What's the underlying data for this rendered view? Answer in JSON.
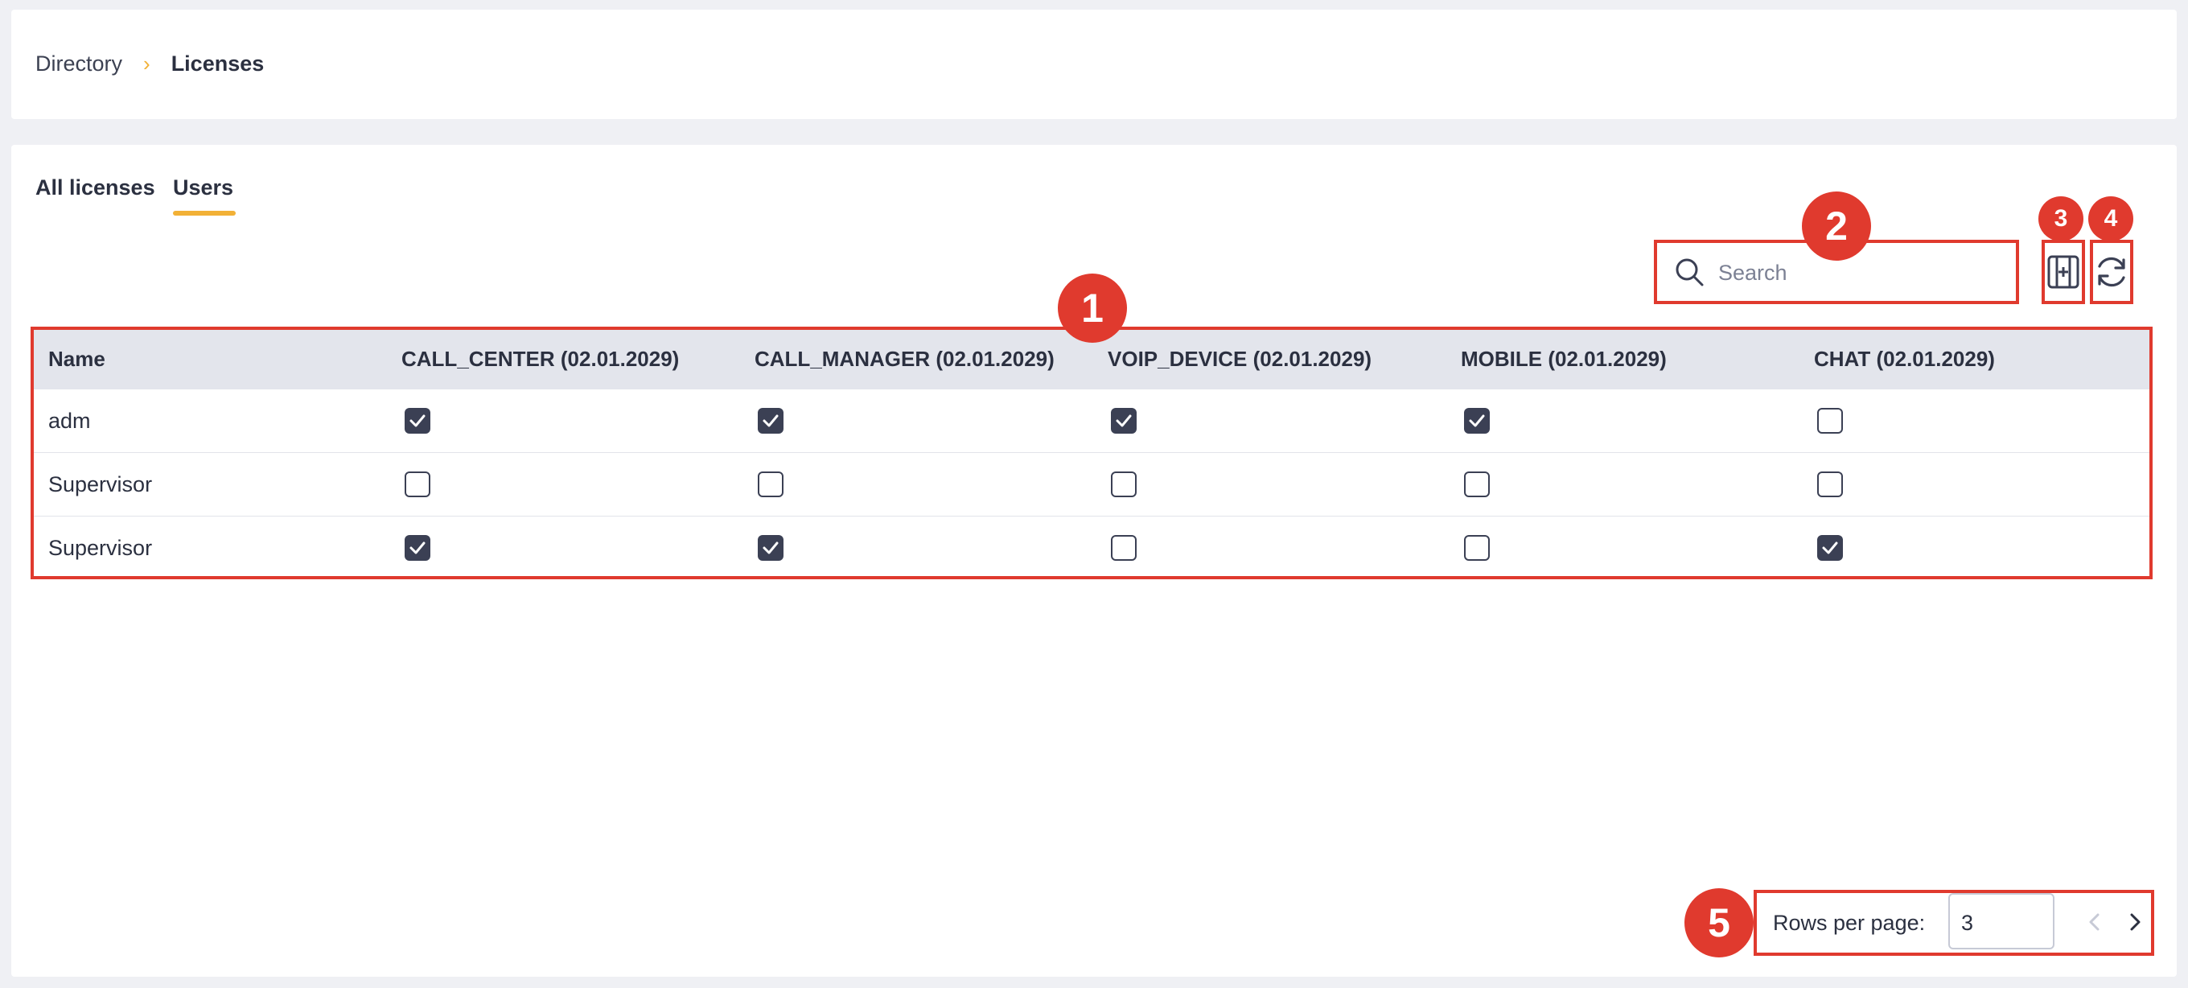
{
  "breadcrumb": {
    "parent": "Directory",
    "separator": "›",
    "current": "Licenses"
  },
  "tabs": [
    {
      "label": "All licenses",
      "active": false
    },
    {
      "label": "Users",
      "active": true
    }
  ],
  "search": {
    "placeholder": "Search",
    "value": ""
  },
  "toolbar": {
    "columns_icon": "columns-icon",
    "refresh_icon": "refresh-icon"
  },
  "table": {
    "headers": [
      "Name",
      "CALL_CENTER (02.01.2029)",
      "CALL_MANAGER (02.01.2029)",
      "VOIP_DEVICE (02.01.2029)",
      "MOBILE (02.01.2029)",
      "CHAT (02.01.2029)"
    ],
    "rows": [
      {
        "name": "adm",
        "checks": [
          true,
          true,
          true,
          true,
          false
        ]
      },
      {
        "name": "Supervisor",
        "checks": [
          false,
          false,
          false,
          false,
          false
        ]
      },
      {
        "name": "Supervisor",
        "checks": [
          true,
          true,
          false,
          false,
          true
        ]
      }
    ]
  },
  "pagination": {
    "rows_per_page_label": "Rows per page:",
    "rows_per_page": "3"
  },
  "annotations": [
    "1",
    "2",
    "3",
    "4",
    "5"
  ],
  "colors": {
    "accent": "#f2b136",
    "highlight": "#e03a2e",
    "checkbox": "#3b4054",
    "header_bg": "#e3e5ec"
  }
}
